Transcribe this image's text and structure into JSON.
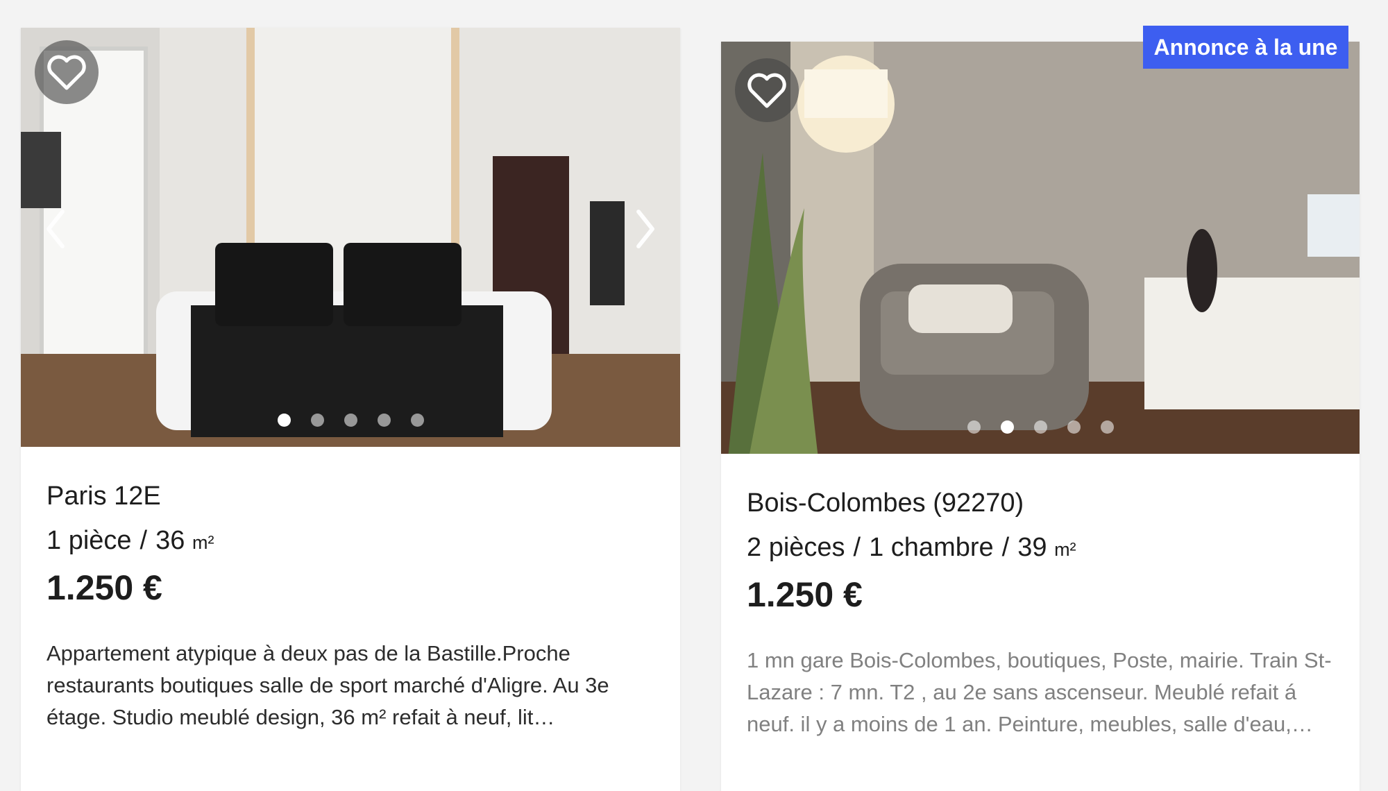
{
  "listings": [
    {
      "city": "Paris 12E",
      "rooms": "1 pièce",
      "area": "36",
      "unit": "m²",
      "price": "1.250 €",
      "description": "Appartement atypique à deux pas de la Bastille.Proche restaurants boutiques salle de sport marché d'Aligre. Au 3e étage. Studio meublé design, 36 m² refait à neuf, lit…",
      "photo_count": 5,
      "active_photo": 1
    },
    {
      "city": "Bois-Colombes (92270)",
      "rooms": "2 pièces",
      "bedrooms": "1 chambre",
      "area": "39",
      "unit": "m²",
      "price": "1.250 €",
      "description": "1 mn gare Bois-Colombes, boutiques, Poste, mairie. Train St-Lazare : 7 mn. T2 , au 2e sans ascenseur. Meublé refait á neuf. il y a moins de 1 an. Peinture, meubles, salle d'eau,…",
      "badge": "Annonce à la une",
      "photo_count": 5,
      "active_photo": 2
    }
  ],
  "separator": "/",
  "icons": {
    "favorite": "heart-outline-icon",
    "prev": "chevron-left-icon",
    "next": "chevron-right-icon"
  },
  "colors": {
    "badge": "#3d5ef0",
    "background": "#f3f3f3"
  }
}
